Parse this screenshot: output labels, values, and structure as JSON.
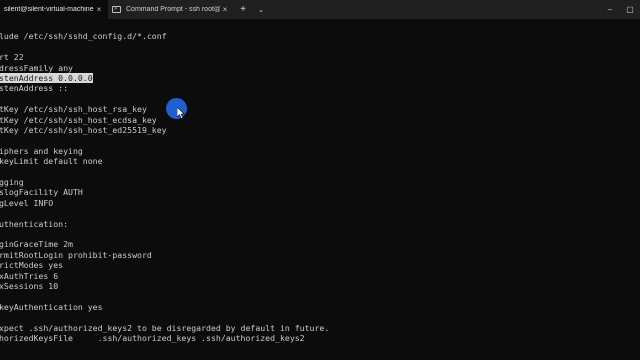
{
  "tabs": [
    {
      "title": "silent@silent-virtual-machine",
      "close": "×",
      "active": true
    },
    {
      "title": "Command Prompt - ssh  root@",
      "close": "×",
      "active": false
    }
  ],
  "tabbar": {
    "new_tab": "+",
    "dropdown": "⌄"
  },
  "window_controls": {
    "minimize": "–",
    "maximize": "▢"
  },
  "terminal": {
    "lines": [
      "lude /etc/ssh/sshd_config.d/*.conf",
      "",
      "rt 22",
      "dressFamily any",
      "stenAddress 0.0.0.0",
      "stenAddress ::",
      "",
      "tKey /etc/ssh/ssh_host_rsa_key",
      "tKey /etc/ssh/ssh_host_ecdsa_key",
      "tKey /etc/ssh/ssh_host_ed25519_key",
      "",
      "iphers and keying",
      "keyLimit default none",
      "",
      "gging",
      "slogFacility AUTH",
      "gLevel INFO",
      "",
      "uthentication:",
      "",
      "ginGraceTime 2m",
      "rmitRootLogin prohibit-password",
      "rictModes yes",
      "xAuthTries 6",
      "xSessions 10",
      "",
      "keyAuthentication yes",
      "",
      "xpect .ssh/authorized_keys2 to be disregarded by default in future.",
      "horizedKeysFile     .ssh/authorized_keys .ssh/authorized_keys2"
    ],
    "selected_line_index": 4
  }
}
